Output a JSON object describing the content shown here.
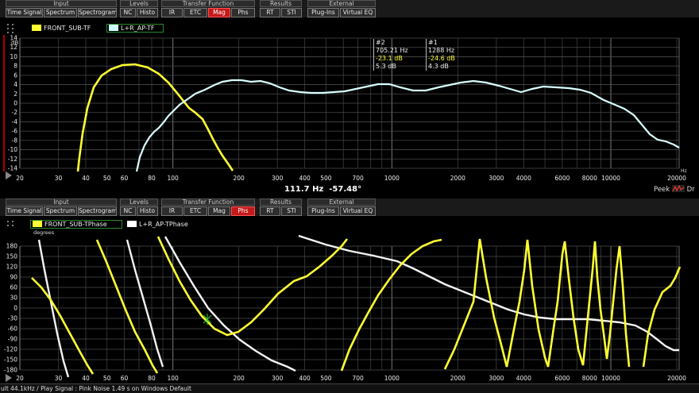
{
  "toolbar": {
    "groups": [
      {
        "title": "Input",
        "buttons": [
          "Time Signal",
          "Spectrum",
          "Spectrogram"
        ]
      },
      {
        "title": "Levels",
        "buttons": [
          "NC",
          "Histo"
        ]
      },
      {
        "title": "Transfer Function",
        "buttons": [
          "IR",
          "ETC",
          "Mag",
          "Phs"
        ]
      },
      {
        "title": "Results",
        "buttons": [
          "RT",
          "STI"
        ]
      },
      {
        "title": "External",
        "buttons": [
          "Plug-Ins",
          "Virtual EQ"
        ]
      }
    ],
    "active_top": "Mag",
    "active_bottom": "Phs"
  },
  "top": {
    "legend": [
      {
        "label": "FRONT_SUB-TF",
        "color": "#ffff33"
      },
      {
        "label": "L+R_AP-TF",
        "color": "#ccffff"
      }
    ],
    "unit": "dB",
    "y_ticks": [
      "14",
      "12",
      "10",
      "8",
      "6",
      "4",
      "2",
      "0",
      "-2",
      "-4",
      "-6",
      "-8",
      "-10",
      "-12",
      "-14"
    ],
    "x_ticks": [
      "20",
      "30",
      "40",
      "50",
      "60",
      "80",
      "100",
      "200",
      "300",
      "400",
      "500",
      "700",
      "1000",
      "2000",
      "3000",
      "4000",
      "6000",
      "8000",
      "10000",
      "20000"
    ],
    "x_unit": "Hz",
    "cursors": [
      {
        "id": "#2",
        "freq": "705.21 Hz",
        "val1": "-23.1 dB",
        "val2": "5.3 dB"
      },
      {
        "id": "#1",
        "freq": "1288 Hz",
        "val1": "-24.6 dB",
        "val2": "4.3 dB"
      }
    ]
  },
  "readout": {
    "freq": "111.7 Hz",
    "phase": "-57.48°"
  },
  "peek": "Peek",
  "peek_trail": "Dr",
  "bottom": {
    "legend": [
      {
        "label": "FRONT_SUB-TPhase",
        "color": "#ffff33"
      },
      {
        "label": "L+R_AP-TPhase",
        "color": "#ffffff"
      }
    ],
    "unit": "degrees",
    "y_ticks": [
      "180",
      "150",
      "120",
      "90",
      "60",
      "30",
      "0",
      "-30",
      "-60",
      "-90",
      "-120",
      "-150",
      "-180"
    ],
    "x_ticks": [
      "20",
      "30",
      "40",
      "50",
      "60",
      "80",
      "100",
      "200",
      "300",
      "400",
      "500",
      "700",
      "1000",
      "2000",
      "3000",
      "4000",
      "6000",
      "8000",
      "10000",
      "20000"
    ]
  },
  "status": "ult 44.1kHz / Play Signal : Pink Noise  1.49 s on Windows Default"
}
